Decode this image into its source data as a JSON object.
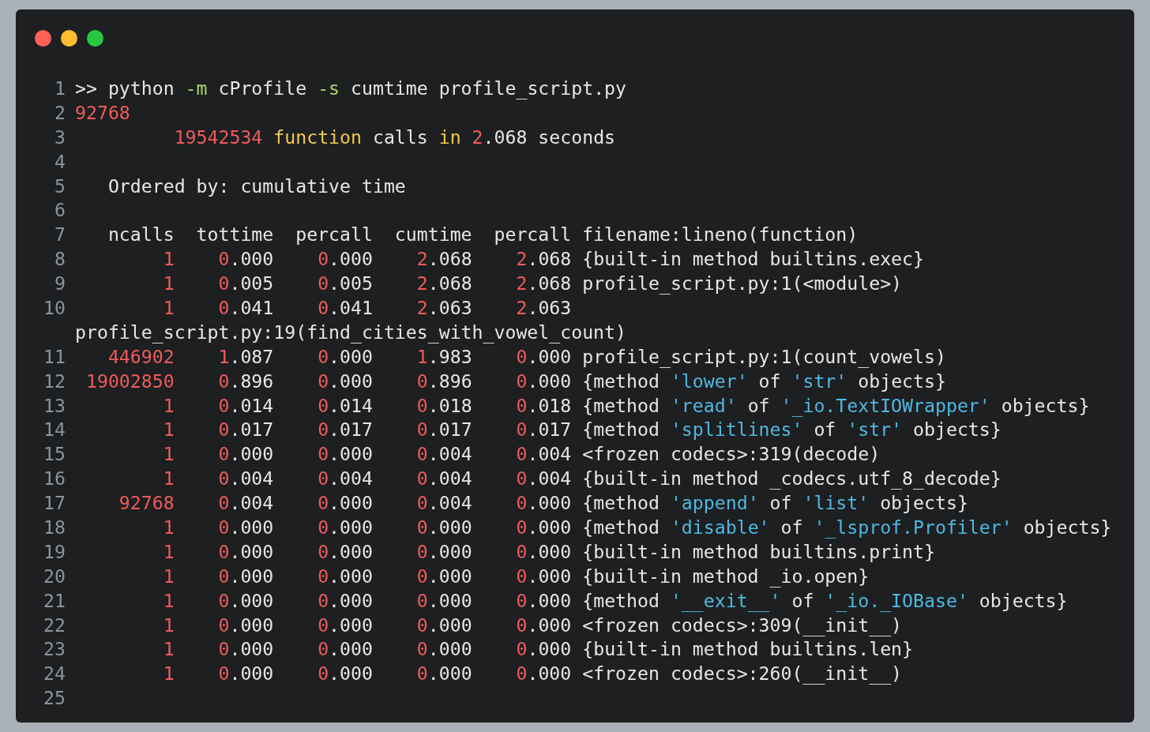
{
  "lines": [
    {
      "number": "1",
      "tokens": [
        {
          "text": ">> python "
        },
        {
          "text": "-m",
          "kind": "flag"
        },
        {
          "text": " cProfile "
        },
        {
          "text": "-s",
          "kind": "flag"
        },
        {
          "text": " cumtime profile_script.py"
        }
      ]
    },
    {
      "number": "2",
      "tokens": [
        {
          "text": "92768",
          "kind": "number"
        }
      ]
    },
    {
      "number": "3",
      "tokens": [
        {
          "text": "         19542534",
          "kind": "number"
        },
        {
          "text": " function",
          "kind": "keyword"
        },
        {
          "text": " calls "
        },
        {
          "text": "in",
          "kind": "keyword"
        },
        {
          "text": " 2",
          "kind": "number"
        },
        {
          "text": ".068 seconds"
        }
      ]
    },
    {
      "number": "4"
    },
    {
      "number": "5",
      "tokens": [
        {
          "text": "   Ordered by: cumulative time"
        }
      ]
    },
    {
      "number": "6"
    },
    {
      "number": "7",
      "tokens": [
        {
          "text": "   ncalls  tottime  percall  cumtime  percall filename:lineno(function)"
        }
      ]
    },
    {
      "number": "8",
      "tokens": [
        {
          "text": "        1",
          "kind": "number"
        },
        {
          "text": "    0",
          "kind": "number"
        },
        {
          "text": ".000    "
        },
        {
          "text": "0",
          "kind": "number"
        },
        {
          "text": ".000    "
        },
        {
          "text": "2",
          "kind": "number"
        },
        {
          "text": ".068    "
        },
        {
          "text": "2",
          "kind": "number"
        },
        {
          "text": ".068 {built-in method builtins.exec}"
        }
      ]
    },
    {
      "number": "9",
      "tokens": [
        {
          "text": "        1",
          "kind": "number"
        },
        {
          "text": "    0",
          "kind": "number"
        },
        {
          "text": ".005    "
        },
        {
          "text": "0",
          "kind": "number"
        },
        {
          "text": ".005    "
        },
        {
          "text": "2",
          "kind": "number"
        },
        {
          "text": ".068    "
        },
        {
          "text": "2",
          "kind": "number"
        },
        {
          "text": ".068 profile_script.py:1(<module>)"
        }
      ]
    },
    {
      "number": "10",
      "tokens": [
        {
          "text": "        1",
          "kind": "number"
        },
        {
          "text": "    0",
          "kind": "number"
        },
        {
          "text": ".041    "
        },
        {
          "text": "0",
          "kind": "number"
        },
        {
          "text": ".041    "
        },
        {
          "text": "2",
          "kind": "number"
        },
        {
          "text": ".063    "
        },
        {
          "text": "2",
          "kind": "number"
        },
        {
          "text": ".063"
        }
      ]
    },
    {
      "tokens": [
        {
          "text": "profile_script.py:19(find_cities_with_vowel_count)"
        }
      ]
    },
    {
      "number": "11",
      "tokens": [
        {
          "text": "   446902",
          "kind": "number"
        },
        {
          "text": "    1",
          "kind": "number"
        },
        {
          "text": ".087    "
        },
        {
          "text": "0",
          "kind": "number"
        },
        {
          "text": ".000    "
        },
        {
          "text": "1",
          "kind": "number"
        },
        {
          "text": ".983    "
        },
        {
          "text": "0",
          "kind": "number"
        },
        {
          "text": ".000 profile_script.py:1(count_vowels)"
        }
      ]
    },
    {
      "number": "12",
      "tokens": [
        {
          "text": " 19002850",
          "kind": "number"
        },
        {
          "text": "    0",
          "kind": "number"
        },
        {
          "text": ".896    "
        },
        {
          "text": "0",
          "kind": "number"
        },
        {
          "text": ".000    "
        },
        {
          "text": "0",
          "kind": "number"
        },
        {
          "text": ".896    "
        },
        {
          "text": "0",
          "kind": "number"
        },
        {
          "text": ".000 {method "
        },
        {
          "text": "'lower'",
          "kind": "string"
        },
        {
          "text": " of "
        },
        {
          "text": "'str'",
          "kind": "string"
        },
        {
          "text": " objects}"
        }
      ]
    },
    {
      "number": "13",
      "tokens": [
        {
          "text": "        1",
          "kind": "number"
        },
        {
          "text": "    0",
          "kind": "number"
        },
        {
          "text": ".014    "
        },
        {
          "text": "0",
          "kind": "number"
        },
        {
          "text": ".014    "
        },
        {
          "text": "0",
          "kind": "number"
        },
        {
          "text": ".018    "
        },
        {
          "text": "0",
          "kind": "number"
        },
        {
          "text": ".018 {method "
        },
        {
          "text": "'read'",
          "kind": "string"
        },
        {
          "text": " of "
        },
        {
          "text": "'_io.TextIOWrapper'",
          "kind": "string"
        },
        {
          "text": " objects}"
        }
      ]
    },
    {
      "number": "14",
      "tokens": [
        {
          "text": "        1",
          "kind": "number"
        },
        {
          "text": "    0",
          "kind": "number"
        },
        {
          "text": ".017    "
        },
        {
          "text": "0",
          "kind": "number"
        },
        {
          "text": ".017    "
        },
        {
          "text": "0",
          "kind": "number"
        },
        {
          "text": ".017    "
        },
        {
          "text": "0",
          "kind": "number"
        },
        {
          "text": ".017 {method "
        },
        {
          "text": "'splitlines'",
          "kind": "string"
        },
        {
          "text": " of "
        },
        {
          "text": "'str'",
          "kind": "string"
        },
        {
          "text": " objects}"
        }
      ]
    },
    {
      "number": "15",
      "tokens": [
        {
          "text": "        1",
          "kind": "number"
        },
        {
          "text": "    0",
          "kind": "number"
        },
        {
          "text": ".000    "
        },
        {
          "text": "0",
          "kind": "number"
        },
        {
          "text": ".000    "
        },
        {
          "text": "0",
          "kind": "number"
        },
        {
          "text": ".004    "
        },
        {
          "text": "0",
          "kind": "number"
        },
        {
          "text": ".004 <frozen codecs>:319(decode)"
        }
      ]
    },
    {
      "number": "16",
      "tokens": [
        {
          "text": "        1",
          "kind": "number"
        },
        {
          "text": "    0",
          "kind": "number"
        },
        {
          "text": ".004    "
        },
        {
          "text": "0",
          "kind": "number"
        },
        {
          "text": ".004    "
        },
        {
          "text": "0",
          "kind": "number"
        },
        {
          "text": ".004    "
        },
        {
          "text": "0",
          "kind": "number"
        },
        {
          "text": ".004 {built-in method _codecs.utf_8_decode}"
        }
      ]
    },
    {
      "number": "17",
      "tokens": [
        {
          "text": "    92768",
          "kind": "number"
        },
        {
          "text": "    0",
          "kind": "number"
        },
        {
          "text": ".004    "
        },
        {
          "text": "0",
          "kind": "number"
        },
        {
          "text": ".000    "
        },
        {
          "text": "0",
          "kind": "number"
        },
        {
          "text": ".004    "
        },
        {
          "text": "0",
          "kind": "number"
        },
        {
          "text": ".000 {method "
        },
        {
          "text": "'append'",
          "kind": "string"
        },
        {
          "text": " of "
        },
        {
          "text": "'list'",
          "kind": "string"
        },
        {
          "text": " objects}"
        }
      ]
    },
    {
      "number": "18",
      "tokens": [
        {
          "text": "        1",
          "kind": "number"
        },
        {
          "text": "    0",
          "kind": "number"
        },
        {
          "text": ".000    "
        },
        {
          "text": "0",
          "kind": "number"
        },
        {
          "text": ".000    "
        },
        {
          "text": "0",
          "kind": "number"
        },
        {
          "text": ".000    "
        },
        {
          "text": "0",
          "kind": "number"
        },
        {
          "text": ".000 {method "
        },
        {
          "text": "'disable'",
          "kind": "string"
        },
        {
          "text": " of "
        },
        {
          "text": "'_lsprof.Profiler'",
          "kind": "string"
        },
        {
          "text": " objects}"
        }
      ]
    },
    {
      "number": "19",
      "tokens": [
        {
          "text": "        1",
          "kind": "number"
        },
        {
          "text": "    0",
          "kind": "number"
        },
        {
          "text": ".000    "
        },
        {
          "text": "0",
          "kind": "number"
        },
        {
          "text": ".000    "
        },
        {
          "text": "0",
          "kind": "number"
        },
        {
          "text": ".000    "
        },
        {
          "text": "0",
          "kind": "number"
        },
        {
          "text": ".000 {built-in method builtins.print}"
        }
      ]
    },
    {
      "number": "20",
      "tokens": [
        {
          "text": "        1",
          "kind": "number"
        },
        {
          "text": "    0",
          "kind": "number"
        },
        {
          "text": ".000    "
        },
        {
          "text": "0",
          "kind": "number"
        },
        {
          "text": ".000    "
        },
        {
          "text": "0",
          "kind": "number"
        },
        {
          "text": ".000    "
        },
        {
          "text": "0",
          "kind": "number"
        },
        {
          "text": ".000 {built-in method _io.open}"
        }
      ]
    },
    {
      "number": "21",
      "tokens": [
        {
          "text": "        1",
          "kind": "number"
        },
        {
          "text": "    0",
          "kind": "number"
        },
        {
          "text": ".000    "
        },
        {
          "text": "0",
          "kind": "number"
        },
        {
          "text": ".000    "
        },
        {
          "text": "0",
          "kind": "number"
        },
        {
          "text": ".000    "
        },
        {
          "text": "0",
          "kind": "number"
        },
        {
          "text": ".000 {method "
        },
        {
          "text": "'__exit__'",
          "kind": "string"
        },
        {
          "text": " of "
        },
        {
          "text": "'_io._IOBase'",
          "kind": "string"
        },
        {
          "text": " objects}"
        }
      ]
    },
    {
      "number": "22",
      "tokens": [
        {
          "text": "        1",
          "kind": "number"
        },
        {
          "text": "    0",
          "kind": "number"
        },
        {
          "text": ".000    "
        },
        {
          "text": "0",
          "kind": "number"
        },
        {
          "text": ".000    "
        },
        {
          "text": "0",
          "kind": "number"
        },
        {
          "text": ".000    "
        },
        {
          "text": "0",
          "kind": "number"
        },
        {
          "text": ".000 <frozen codecs>:309(__init__)"
        }
      ]
    },
    {
      "number": "23",
      "tokens": [
        {
          "text": "        1",
          "kind": "number"
        },
        {
          "text": "    0",
          "kind": "number"
        },
        {
          "text": ".000    "
        },
        {
          "text": "0",
          "kind": "number"
        },
        {
          "text": ".000    "
        },
        {
          "text": "0",
          "kind": "number"
        },
        {
          "text": ".000    "
        },
        {
          "text": "0",
          "kind": "number"
        },
        {
          "text": ".000 {built-in method builtins.len}"
        }
      ]
    },
    {
      "number": "24",
      "tokens": [
        {
          "text": "        1",
          "kind": "number"
        },
        {
          "text": "    0",
          "kind": "number"
        },
        {
          "text": ".000    "
        },
        {
          "text": "0",
          "kind": "number"
        },
        {
          "text": ".000    "
        },
        {
          "text": "0",
          "kind": "number"
        },
        {
          "text": ".000    "
        },
        {
          "text": "0",
          "kind": "number"
        },
        {
          "text": ".000 <frozen codecs>:260(__init__)"
        }
      ]
    },
    {
      "number": "25"
    }
  ]
}
